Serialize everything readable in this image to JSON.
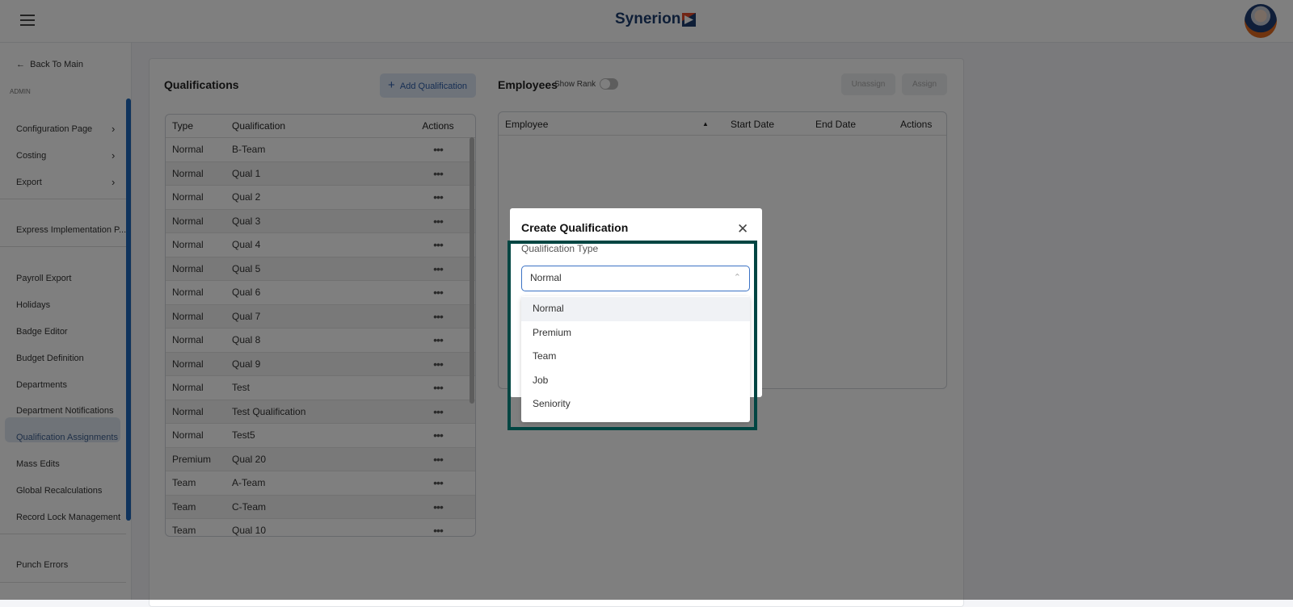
{
  "header": {
    "logo": "Synerion",
    "menu_icon": "hamburger-icon",
    "avatar": "user-avatar"
  },
  "sidebar": {
    "back": "Back To Main",
    "section": "ADMIN",
    "items": [
      {
        "label": "Configuration Page",
        "chevron": true
      },
      {
        "label": "Costing",
        "chevron": true
      },
      {
        "label": "Export",
        "chevron": true
      },
      {
        "label": "Express Implementation P..."
      },
      {
        "label": "Payroll Export"
      },
      {
        "label": "Holidays"
      },
      {
        "label": "Badge Editor"
      },
      {
        "label": "Budget Definition"
      },
      {
        "label": "Departments"
      },
      {
        "label": "Department Notifications"
      },
      {
        "label": "Qualification Assignments",
        "selected": true
      },
      {
        "label": "Mass Edits"
      },
      {
        "label": "Global Recalculations"
      },
      {
        "label": "Record Lock Management"
      },
      {
        "label": "Punch Errors"
      }
    ]
  },
  "qualifications": {
    "title": "Qualifications",
    "add_label": "Add Qualification",
    "columns": [
      "Type",
      "Qualification",
      "Actions"
    ],
    "rows": [
      [
        "Normal",
        "B-Team"
      ],
      [
        "Normal",
        "Qual 1"
      ],
      [
        "Normal",
        "Qual 2"
      ],
      [
        "Normal",
        "Qual 3"
      ],
      [
        "Normal",
        "Qual 4"
      ],
      [
        "Normal",
        "Qual 5"
      ],
      [
        "Normal",
        "Qual 6"
      ],
      [
        "Normal",
        "Qual 7"
      ],
      [
        "Normal",
        "Qual 8"
      ],
      [
        "Normal",
        "Qual 9"
      ],
      [
        "Normal",
        "Test"
      ],
      [
        "Normal",
        "Test Qualification"
      ],
      [
        "Normal",
        "Test5"
      ],
      [
        "Premium",
        "Qual 20"
      ],
      [
        "Team",
        "A-Team"
      ],
      [
        "Team",
        "C-Team"
      ],
      [
        "Team",
        "Qual 10"
      ]
    ]
  },
  "employees": {
    "title": "Employees",
    "show_rank": "Show Rank",
    "show_rank_on": false,
    "unassign": "Unassign",
    "assign": "Assign",
    "columns": [
      "Employee",
      "Start Date",
      "End Date",
      "Actions"
    ]
  },
  "modal": {
    "title": "Create Qualification",
    "field_label": "Qualification Type",
    "selected": "Normal",
    "options": [
      "Normal",
      "Premium",
      "Team",
      "Job",
      "Seniority"
    ],
    "highlight_color": "#004542"
  }
}
